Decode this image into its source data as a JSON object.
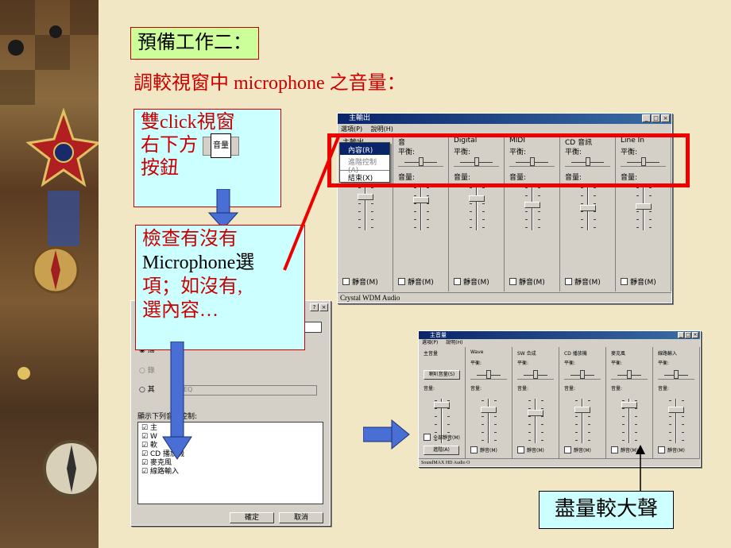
{
  "slide": {
    "heading": "預備工作二：",
    "subtitle": "調較視窗中 microphone 之音量：",
    "callout1_lines": [
      "雙click視窗",
      "右下方",
      "按鈕"
    ],
    "callout1_icon_label": "音量",
    "callout2_lines": [
      "檢查有沒有",
      "Microphone選",
      "項；如沒有,",
      "選內容…"
    ],
    "callout3": "盡量較大聲"
  },
  "main_mixer": {
    "title": "主輸出",
    "menu": [
      "選項(P)",
      "說明(H)"
    ],
    "dropdown": [
      "內容(R)",
      "進階控制(A)",
      "結束(X)"
    ],
    "columns": [
      {
        "name": "主輸出",
        "balance": "平衡:",
        "volume": "音量:",
        "mute": "靜音(M)"
      },
      {
        "name": "音",
        "balance": "平衡:",
        "volume": "音量:",
        "mute": "靜音(M)"
      },
      {
        "name": "Digital",
        "balance": "平衡:",
        "volume": "音量:",
        "mute": "靜音(M)"
      },
      {
        "name": "MIDI",
        "balance": "平衡:",
        "volume": "音量:",
        "mute": "靜音(M)"
      },
      {
        "name": "CD 音訊",
        "balance": "平衡:",
        "volume": "音量:",
        "mute": "靜音(M)"
      },
      {
        "name": "Line In",
        "balance": "平衡:",
        "volume": "音量:",
        "mute": "靜音(M)"
      }
    ],
    "status": "Crystal WDM Audio"
  },
  "props_dialog": {
    "help_close": [
      "?",
      "×"
    ],
    "radio_labels": [
      "播",
      "錄",
      "其"
    ],
    "other_select": "EQ",
    "list_caption": "顯示下列音量控制:",
    "items": [
      "主",
      "W",
      "軟",
      "CD 播放機",
      "麥克風",
      "線路輸入"
    ],
    "ok": "確定",
    "cancel": "取消"
  },
  "second_mixer": {
    "title": "主音量",
    "menu": [
      "選項(P)",
      "說明(H)"
    ],
    "columns": [
      {
        "name": "主音量",
        "balance": "",
        "volume": "音量:",
        "mute": "全部靜音(M)",
        "extra_button": "喇叭音量(S)",
        "advanced": "進階(A)"
      },
      {
        "name": "Wave",
        "balance": "平衡:",
        "volume": "音量:",
        "mute": "靜音(M)"
      },
      {
        "name": "SW 合成",
        "balance": "平衡:",
        "volume": "音量:",
        "mute": "靜音(M)"
      },
      {
        "name": "CD 播放機",
        "balance": "平衡:",
        "volume": "音量:",
        "mute": "靜音(M)"
      },
      {
        "name": "麥克風",
        "balance": "平衡:",
        "volume": "音量:",
        "mute": "靜音(M)"
      },
      {
        "name": "線路輸入",
        "balance": "平衡:",
        "volume": "音量:",
        "mute": "靜音(M)"
      }
    ],
    "status": "SoundMAX HD Audio O"
  },
  "colors": {
    "background": "#f2e7c4",
    "accent_red": "#cc0000",
    "arrow_blue": "#4a6fd4",
    "callout_cyan": "#ccffff",
    "heading_green": "#ccff99"
  }
}
